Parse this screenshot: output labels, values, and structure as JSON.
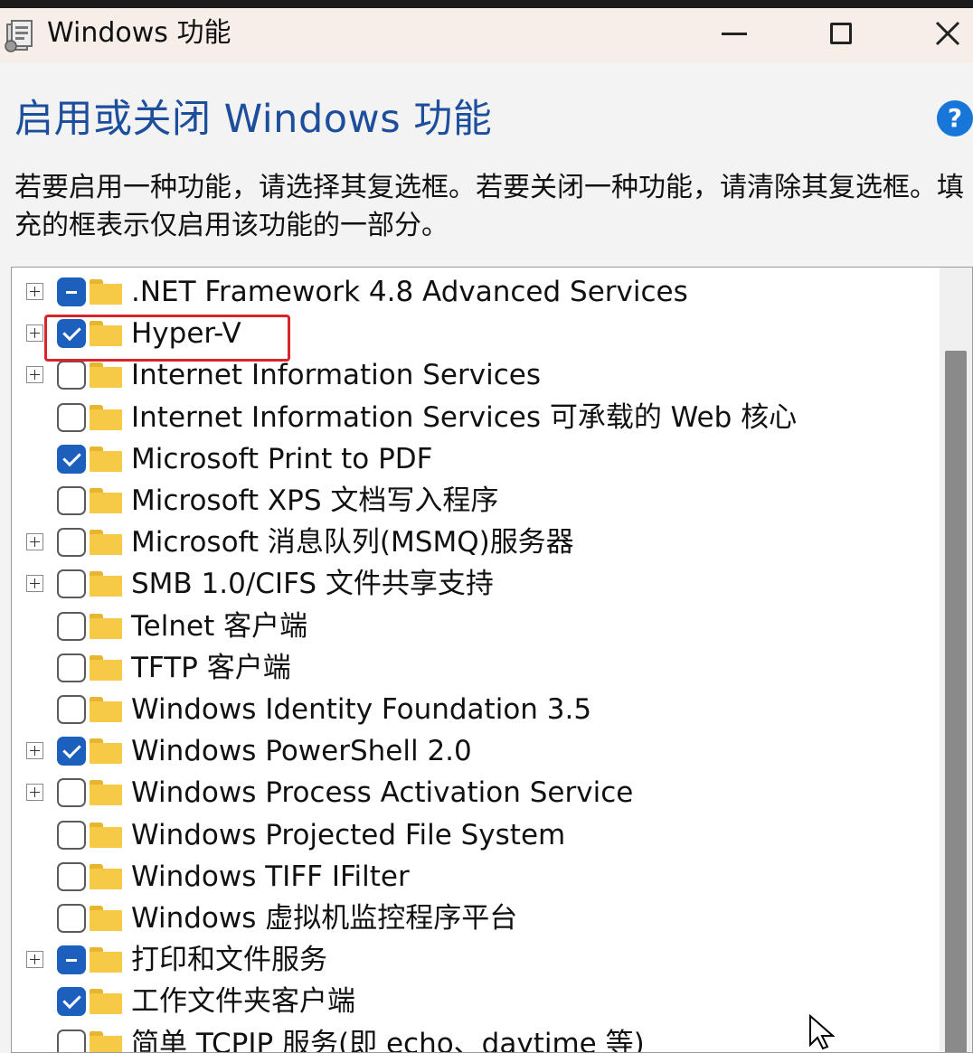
{
  "window": {
    "title": "Windows 功能"
  },
  "heading": "启用或关闭 Windows 功能",
  "help_glyph": "?",
  "description": "若要启用一种功能，请选择其复选框。若要关闭一种功能，请清除其复选框。填充的框表示仅启用该功能的一部分。",
  "features": [
    {
      "label": ".NET Framework 4.8 Advanced Services",
      "state": "partial",
      "expandable": true
    },
    {
      "label": "Hyper-V",
      "state": "checked",
      "expandable": true,
      "highlighted": true
    },
    {
      "label": "Internet Information Services",
      "state": "unchecked",
      "expandable": true
    },
    {
      "label": "Internet Information Services 可承载的 Web 核心",
      "state": "unchecked",
      "expandable": false
    },
    {
      "label": "Microsoft Print to PDF",
      "state": "checked",
      "expandable": false
    },
    {
      "label": "Microsoft XPS 文档写入程序",
      "state": "unchecked",
      "expandable": false
    },
    {
      "label": "Microsoft 消息队列(MSMQ)服务器",
      "state": "unchecked",
      "expandable": true
    },
    {
      "label": "SMB 1.0/CIFS 文件共享支持",
      "state": "unchecked",
      "expandable": true
    },
    {
      "label": "Telnet 客户端",
      "state": "unchecked",
      "expandable": false
    },
    {
      "label": "TFTP 客户端",
      "state": "unchecked",
      "expandable": false
    },
    {
      "label": "Windows Identity Foundation 3.5",
      "state": "unchecked",
      "expandable": false
    },
    {
      "label": "Windows PowerShell 2.0",
      "state": "checked",
      "expandable": true
    },
    {
      "label": "Windows Process Activation Service",
      "state": "unchecked",
      "expandable": true
    },
    {
      "label": "Windows Projected File System",
      "state": "unchecked",
      "expandable": false
    },
    {
      "label": "Windows TIFF IFilter",
      "state": "unchecked",
      "expandable": false
    },
    {
      "label": "Windows 虚拟机监控程序平台",
      "state": "unchecked",
      "expandable": false
    },
    {
      "label": "打印和文件服务",
      "state": "partial",
      "expandable": true
    },
    {
      "label": "工作文件夹客户端",
      "state": "checked",
      "expandable": false
    },
    {
      "label": "简单 TCPIP 服务(即 echo、daytime 等)",
      "state": "unchecked",
      "expandable": false
    }
  ]
}
